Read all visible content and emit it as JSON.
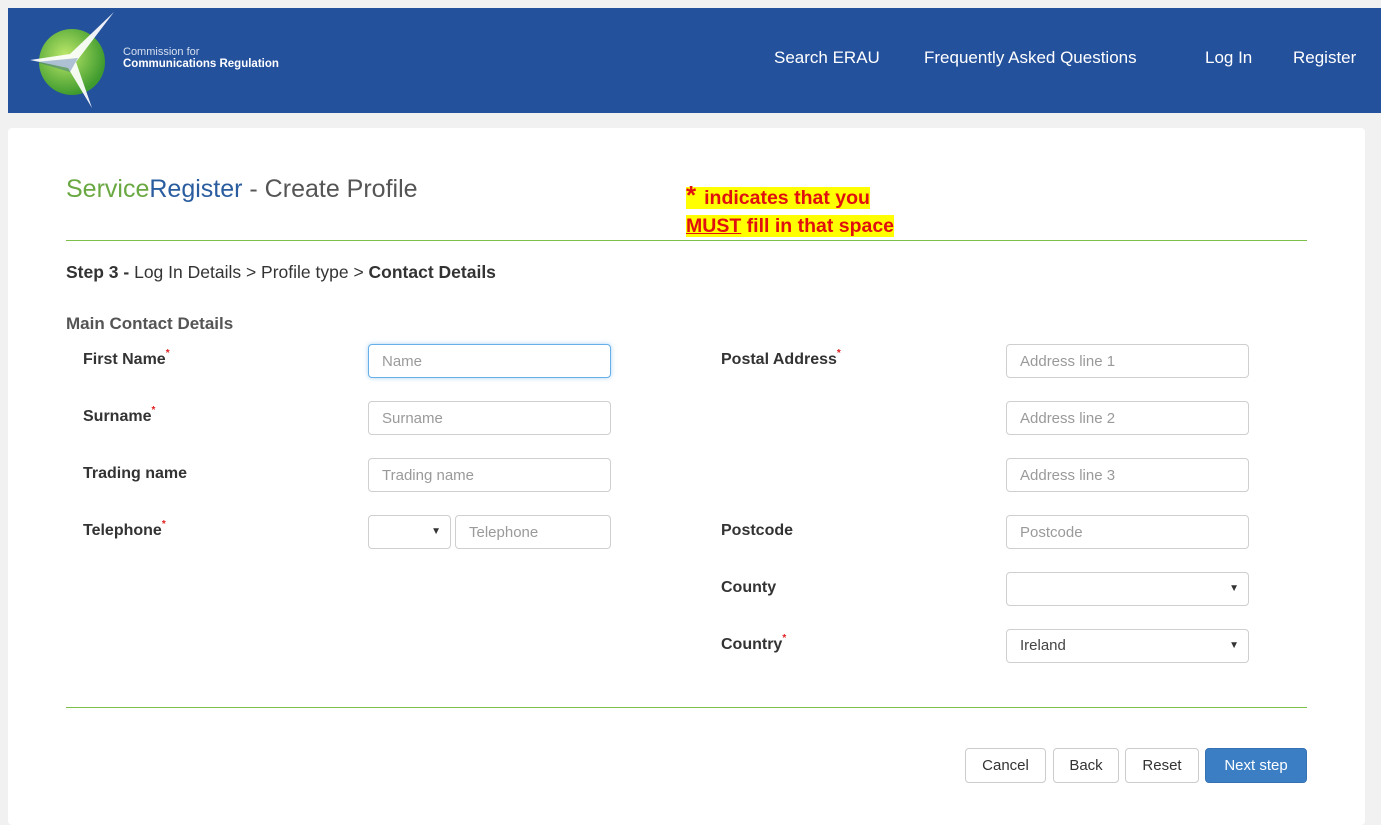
{
  "header": {
    "org_line1": "Commission for",
    "org_line2": "Communications Regulation",
    "nav": [
      {
        "id": "search",
        "label": "Search ERAU"
      },
      {
        "id": "faq",
        "label": "Frequently Asked Questions"
      },
      {
        "id": "login",
        "label": "Log In"
      },
      {
        "id": "register",
        "label": "Register"
      }
    ],
    "logo_icon": "comreg-star-logo-icon"
  },
  "page": {
    "title_brand1": "Service",
    "title_brand2": "Register",
    "title_rest": " - Create Profile",
    "notice": {
      "star": "*",
      "line1": "indicates that you",
      "must": "MUST",
      "line2_rest": " fill in that space"
    },
    "step_prefix": "Step 3 -",
    "step_path": " Log In Details > Profile type > ",
    "step_current": "Contact Details",
    "section_title": "Main Contact Details",
    "required_mark": "*"
  },
  "form": {
    "first_name": {
      "label": "First Name",
      "placeholder": "Name",
      "value": ""
    },
    "surname": {
      "label": "Surname",
      "placeholder": "Surname",
      "value": ""
    },
    "trading_name": {
      "label": "Trading name",
      "placeholder": "Trading name",
      "value": ""
    },
    "telephone": {
      "label": "Telephone",
      "code_selected": "",
      "placeholder": "Telephone",
      "value": ""
    },
    "postal_address": {
      "label": "Postal Address",
      "line1": "Address line 1",
      "line2": "Address line 2",
      "line3": "Address line 3"
    },
    "postcode": {
      "label": "Postcode",
      "placeholder": "Postcode"
    },
    "county": {
      "label": "County",
      "selected": ""
    },
    "country": {
      "label": "Country",
      "selected": "Ireland"
    }
  },
  "buttons": {
    "cancel": "Cancel",
    "back": "Back",
    "reset": "Reset",
    "next": "Next step"
  },
  "colors": {
    "header_bg": "#24519c",
    "brand_green": "#6aa842",
    "brand_blue": "#2a5d9f",
    "primary_button": "#3c7ec4",
    "divider": "#7cc04b",
    "required": "#e02020",
    "highlight": "#ffff00"
  }
}
